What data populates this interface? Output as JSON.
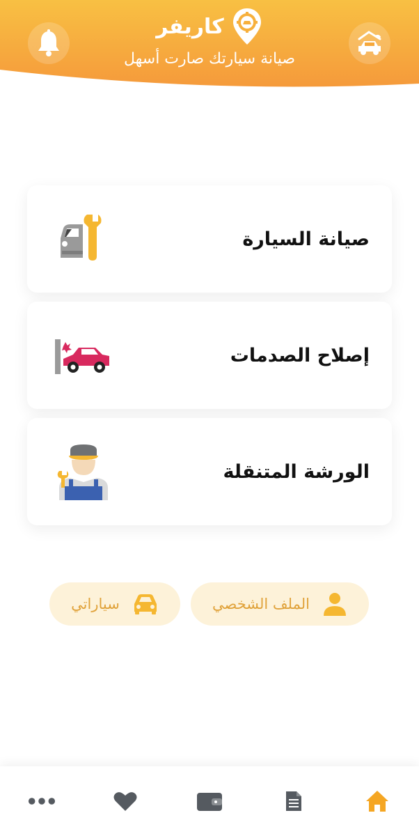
{
  "header": {
    "brand_name": "كاريفر",
    "tagline": "صيانة سيارتك صارت أسهل",
    "gradient_top": "#f6b73c",
    "gradient_bottom": "#f59a3b"
  },
  "icons": {
    "notifications": "bell-icon",
    "tow_truck": "tow-car-icon",
    "logo": "gear-pin-logo-icon"
  },
  "services": [
    {
      "title": "صيانة السيارة",
      "icon": "car-wrench-icon"
    },
    {
      "title": "إصلاح الصدمات",
      "icon": "car-crash-icon"
    },
    {
      "title": "الورشة المتنقلة",
      "icon": "mechanic-icon"
    }
  ],
  "quick_links": {
    "profile_label": "الملف الشخصي",
    "cars_label": "سياراتي"
  },
  "bottom_nav": {
    "items": [
      "home-icon",
      "document-icon",
      "wallet-icon",
      "heart-icon",
      "more-icon"
    ],
    "active": "home-icon"
  },
  "colors": {
    "accent": "#f5a623",
    "pill_bg": "#fdf2d9",
    "pill_text": "#e0a23a",
    "nav_icon": "#555a60"
  }
}
